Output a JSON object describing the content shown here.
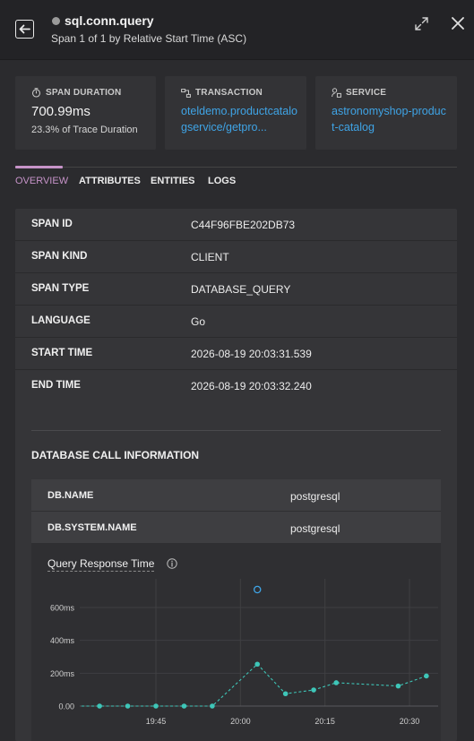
{
  "header": {
    "title": "sql.conn.query",
    "subtitle": "Span 1 of 1 by Relative Start Time (ASC)"
  },
  "cards": {
    "duration": {
      "label": "SPAN DURATION",
      "value": "700.99ms",
      "sub": "23.3% of Trace Duration"
    },
    "transaction": {
      "label": "TRANSACTION",
      "value": "oteldemo.productcatalogservice/getpro..."
    },
    "service": {
      "label": "SERVICE",
      "value": "astronomyshop-product-catalog"
    }
  },
  "tabs": [
    "OVERVIEW",
    "ATTRIBUTES",
    "ENTITIES",
    "LOGS"
  ],
  "attributes": [
    {
      "key": "SPAN ID",
      "value": "C44F96FBE202DB73"
    },
    {
      "key": "SPAN KIND",
      "value": "CLIENT"
    },
    {
      "key": "SPAN TYPE",
      "value": "DATABASE_QUERY"
    },
    {
      "key": "LANGUAGE",
      "value": "Go"
    },
    {
      "key": "START TIME",
      "value": "2026-08-19 20:03:31.539"
    },
    {
      "key": "END TIME",
      "value": "2026-08-19 20:03:32.240"
    }
  ],
  "db_section": {
    "title": "DATABASE CALL INFORMATION",
    "rows": [
      {
        "key": "DB.NAME",
        "value": "postgresql"
      },
      {
        "key": "DB.SYSTEM.NAME",
        "value": "postgresql"
      }
    ]
  },
  "colors": {
    "accent": "#c693c8",
    "link": "#3fa4e6",
    "series": "#3ec6b8",
    "marker": "#3fa4e6"
  },
  "chart_data": {
    "type": "line",
    "title": "Query Response Time",
    "y_ticks": [
      "0.00",
      "200ms",
      "400ms",
      "600ms"
    ],
    "x_ticks": [
      "19:45",
      "20:00",
      "20:15",
      "20:30"
    ],
    "ylim": [
      0,
      700
    ],
    "grid": true,
    "series": [
      {
        "style": "dashed",
        "points": [
          [
            "19:35",
            0
          ],
          [
            "19:40",
            0
          ],
          [
            "19:45",
            0
          ],
          [
            "19:50",
            0
          ],
          [
            "19:55",
            0
          ],
          [
            "20:03",
            255
          ],
          [
            "20:08",
            75
          ],
          [
            "20:13",
            98
          ],
          [
            "20:17",
            142
          ],
          [
            "20:28",
            122
          ],
          [
            "20:33",
            183
          ]
        ]
      }
    ],
    "marker": {
      "x": "20:03",
      "value": 700.99
    }
  }
}
